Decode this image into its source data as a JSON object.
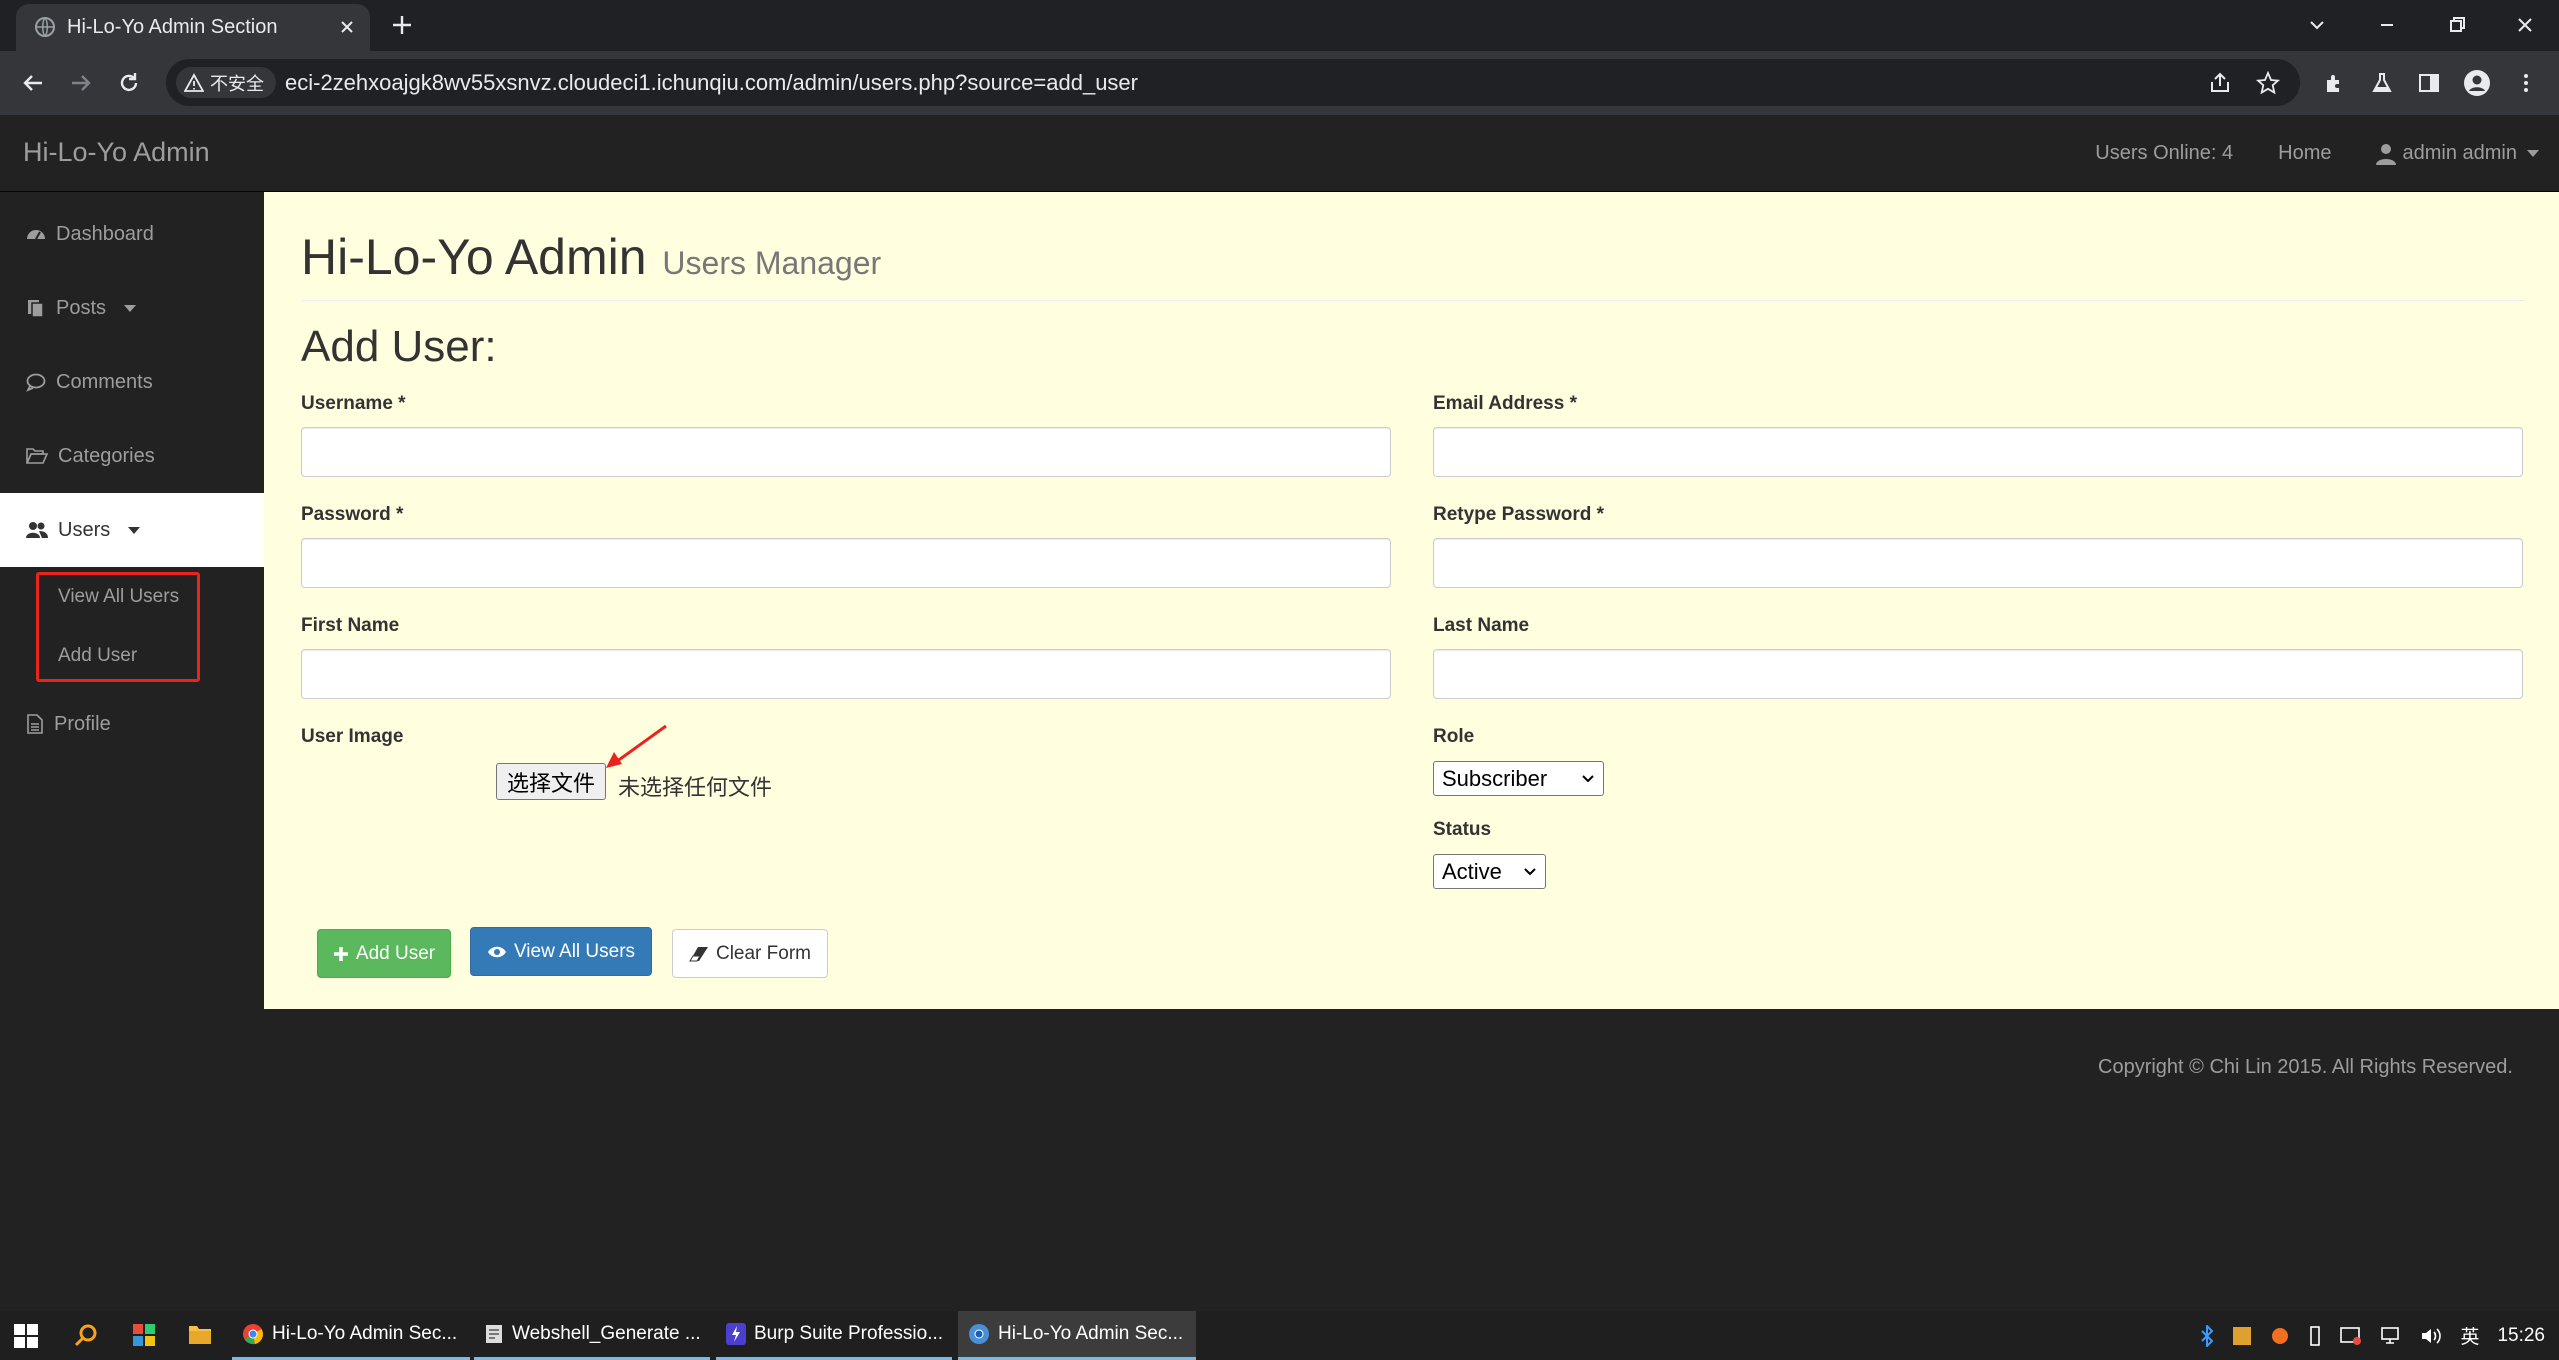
{
  "browser": {
    "tab_title": "Hi-Lo-Yo Admin Section",
    "security_label": "不安全",
    "url": "eci-2zehxoajgk8wv55xsnvz.cloudeci1.ichunqiu.com/admin/users.php?source=add_user"
  },
  "navbar": {
    "brand": "Hi-Lo-Yo Admin",
    "users_online": "Users Online: 4",
    "home": "Home",
    "user_menu": "admin admin"
  },
  "sidebar": {
    "items": [
      {
        "label": "Dashboard",
        "icon": "dashboard-icon"
      },
      {
        "label": "Posts",
        "icon": "files-icon"
      },
      {
        "label": "Comments",
        "icon": "comment-icon"
      },
      {
        "label": "Categories",
        "icon": "folder-open-icon"
      },
      {
        "label": "Users",
        "icon": "users-icon"
      },
      {
        "label": "Profile",
        "icon": "file-icon"
      }
    ],
    "users_submenu": [
      "View All Users",
      "Add User"
    ]
  },
  "page": {
    "title": "Hi-Lo-Yo Admin",
    "subtitle": "Users Manager",
    "form_title": "Add User:"
  },
  "form": {
    "username_label": "Username *",
    "email_label": "Email Address *",
    "password_label": "Password *",
    "retype_password_label": "Retype Password *",
    "first_name_label": "First Name",
    "last_name_label": "Last Name",
    "user_image_label": "User Image",
    "file_button": "选择文件",
    "file_status": "未选择任何文件",
    "role_label": "Role",
    "role_value": "Subscriber",
    "status_label": "Status",
    "status_value": "Active"
  },
  "buttons": {
    "add_user": "Add User",
    "view_all_users": "View All Users",
    "clear_form": "Clear Form"
  },
  "footer": {
    "copyright": "Copyright © Chi Lin 2015. All Rights Reserved."
  },
  "taskbar": {
    "apps": [
      "Hi-Lo-Yo Admin Sec...",
      "Webshell_Generate ...",
      "Burp Suite Professio...",
      "Hi-Lo-Yo Admin Sec..."
    ],
    "ime": "英",
    "time": "15:26"
  },
  "colors": {
    "page_background": "#ffffe0",
    "navbar": "#222222",
    "success": "#5cb85c",
    "primary": "#337ab7",
    "highlight_annotation": "#e8241c"
  }
}
